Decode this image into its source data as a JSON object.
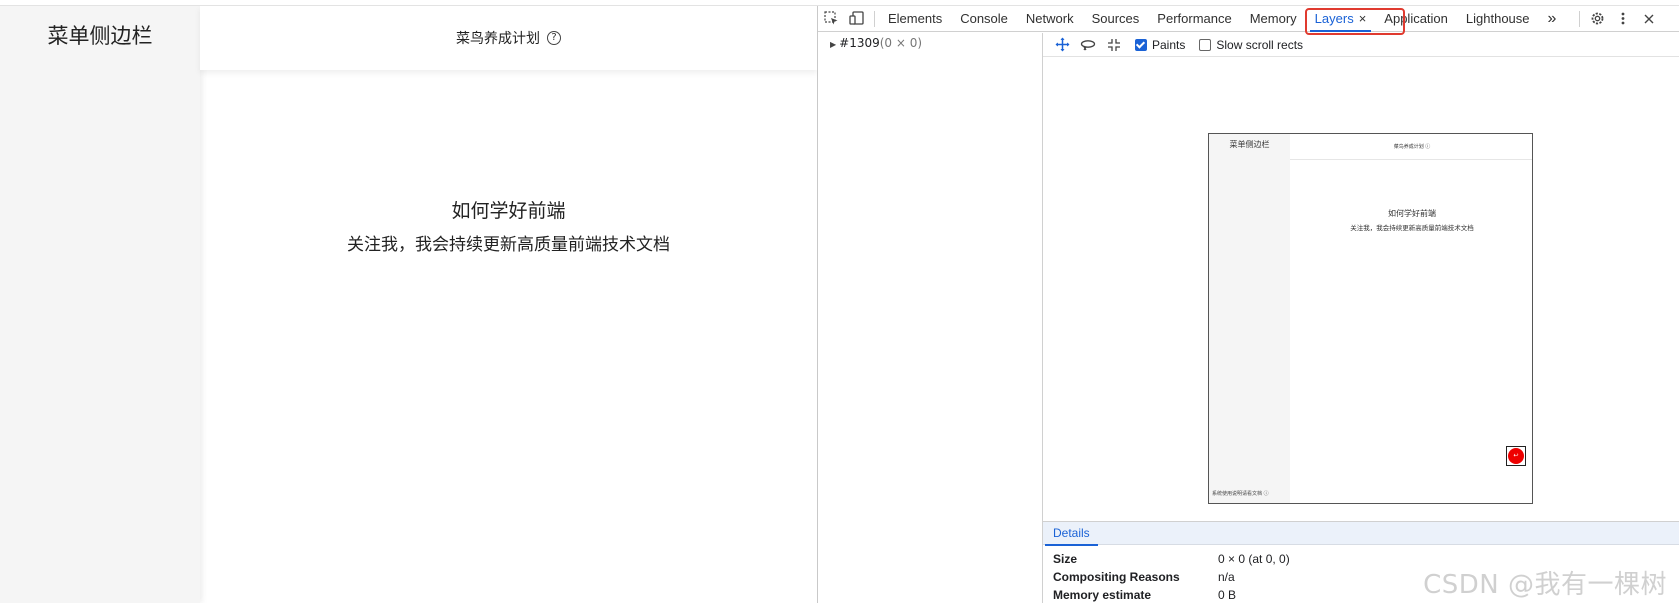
{
  "page": {
    "sidebar_title": "菜单侧边栏",
    "header_title": "菜鸟养成计划",
    "help_glyph": "?",
    "heading": "如何学好前端",
    "subheading": "关注我，我会持续更新高质量前端技术文档"
  },
  "devtools": {
    "tabs": [
      {
        "label": "Elements"
      },
      {
        "label": "Console"
      },
      {
        "label": "Network"
      },
      {
        "label": "Sources"
      },
      {
        "label": "Performance"
      },
      {
        "label": "Memory"
      },
      {
        "label": "Layers",
        "active": true,
        "close": "×"
      },
      {
        "label": "Application"
      },
      {
        "label": "Lighthouse"
      }
    ],
    "more_tabs": "»",
    "tree_node": "#1309",
    "tree_node_size": "(0 × 0)",
    "paints_label": "Paints",
    "paints_checked": true,
    "slow_scroll_label": "Slow scroll rects",
    "slow_scroll_checked": false,
    "details_tab": "Details",
    "details": [
      {
        "key": "Size",
        "value": "0 × 0 (at 0, 0)"
      },
      {
        "key": "Compositing Reasons",
        "value": "n/a"
      },
      {
        "key": "Memory estimate",
        "value": "0 B"
      }
    ],
    "accent_color": "#1a62d6",
    "highlight_color": "#e03a2f"
  },
  "thumbnail": {
    "sidebar_title": "菜单侧边栏",
    "header_title": "菜鸟养成计划 ⓘ",
    "heading": "如何学好前端",
    "subheading": "关注我，我会持续更新高质量前端技术文档",
    "footer": "系统使用说明请看文档 ⓘ",
    "button_glyph": "↩"
  },
  "watermark": "CSDN @我有一棵树"
}
